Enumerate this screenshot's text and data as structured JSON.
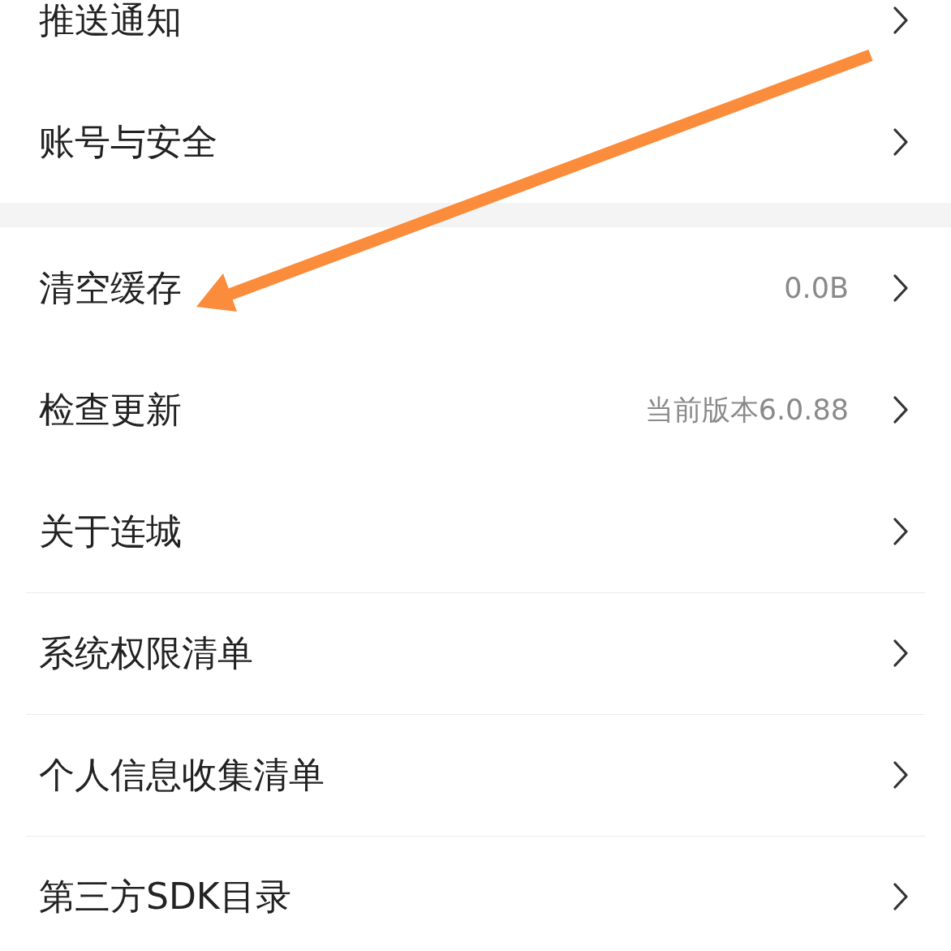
{
  "sections": [
    {
      "items": [
        {
          "label": "推送通知"
        },
        {
          "label": "账号与安全"
        }
      ]
    },
    {
      "items": [
        {
          "label": "清空缓存",
          "value": "0.0B"
        },
        {
          "label": "检查更新",
          "value": "当前版本6.0.88"
        },
        {
          "label": "关于连城"
        },
        {
          "label": "系统权限清单",
          "divider": true
        },
        {
          "label": "个人信息收集清单",
          "divider": true
        },
        {
          "label": "第三方SDK目录",
          "divider": true
        }
      ]
    }
  ]
}
